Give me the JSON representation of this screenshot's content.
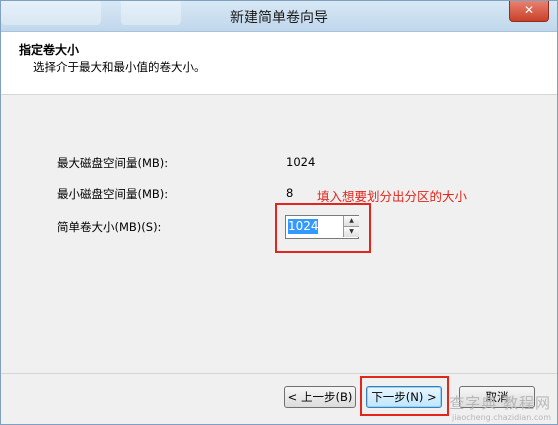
{
  "window": {
    "title": "新建简单卷向导",
    "close_symbol": "✕"
  },
  "header": {
    "title": "指定卷大小",
    "subtitle": "选择介于最大和最小值的卷大小。"
  },
  "fields": {
    "max_label": "最大磁盘空间量(MB):",
    "max_value": "1024",
    "min_label": "最小磁盘空间量(MB):",
    "min_value": "8",
    "size_label": "简单卷大小(MB)(S):",
    "size_value": "1024"
  },
  "annotation": {
    "text": "填入想要划分出分区的大小",
    "color": "#e2261c"
  },
  "buttons": {
    "back": "< 上一步(B)",
    "next": "下一步(N) >",
    "cancel": "取消"
  },
  "watermark": {
    "main": "查字典 教程网",
    "sub": "jiaocheng.chazidian.com"
  }
}
